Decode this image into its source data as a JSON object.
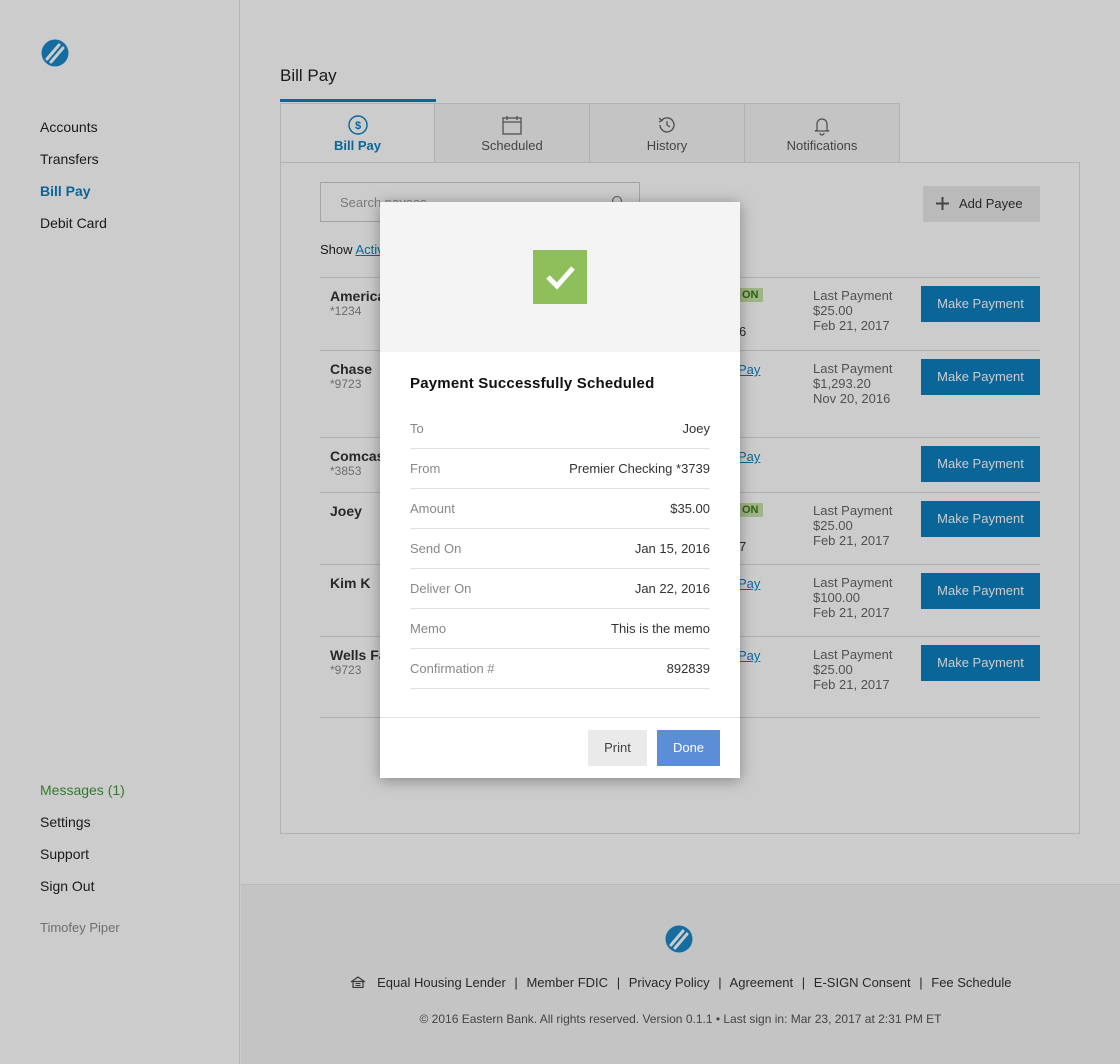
{
  "sidebar": {
    "nav": [
      "Accounts",
      "Transfers",
      "Bill Pay",
      "Debit Card"
    ],
    "active": "Bill Pay",
    "secondary": {
      "messages": "Messages (1)",
      "settings": "Settings",
      "support": "Support",
      "sign_out": "Sign Out"
    },
    "user_name": "Timofey Piper"
  },
  "main": {
    "title": "Bill Pay",
    "tabs": [
      {
        "label": "Bill Pay",
        "icon": "dollar-circle-icon"
      },
      {
        "label": "Scheduled",
        "icon": "calendar-icon"
      },
      {
        "label": "History",
        "icon": "history-icon"
      },
      {
        "label": "Notifications",
        "icon": "bell-icon"
      }
    ],
    "search_placeholder": "Search payees",
    "add_payee": "Add Payee",
    "show_label": "Show",
    "show_filter": "Active",
    "payees": [
      {
        "name": "America",
        "account": "*1234",
        "badge": "ON",
        "trail": "6",
        "last_label": "Last Payment",
        "last_amount": "$25.00",
        "last_date": "Feb 21, 2017",
        "button": "Make Payment"
      },
      {
        "name": "Chase",
        "account": "*9723",
        "link": "Pay",
        "last_label": "Last Payment",
        "last_amount": "$1,293.20",
        "last_date": "Nov 20, 2016",
        "button": "Make Payment"
      },
      {
        "name": "Comcas",
        "account": "*3853",
        "link": "Pay",
        "button": "Make Payment"
      },
      {
        "name": "Joey",
        "account": "",
        "badge": "ON",
        "trail": "7",
        "last_label": "Last Payment",
        "last_amount": "$25.00",
        "last_date": "Feb 21, 2017",
        "button": "Make Payment"
      },
      {
        "name": "Kim K",
        "account": "",
        "link": "Pay",
        "last_label": "Last Payment",
        "last_amount": "$100.00",
        "last_date": "Feb 21, 2017",
        "button": "Make Payment"
      },
      {
        "name": "Wells Fa",
        "account": "*9723",
        "link": "Pay",
        "last_label": "Last Payment",
        "last_amount": "$25.00",
        "last_date": "Feb 21, 2017",
        "button": "Make Payment"
      }
    ]
  },
  "modal": {
    "title": "Payment Successfully Scheduled",
    "rows": [
      {
        "label": "To",
        "value": "Joey"
      },
      {
        "label": "From",
        "value": "Premier Checking *3739"
      },
      {
        "label": "Amount",
        "value": "$35.00"
      },
      {
        "label": "Send On",
        "value": "Jan 15, 2016"
      },
      {
        "label": "Deliver On",
        "value": "Jan 22, 2016"
      },
      {
        "label": "Memo",
        "value": "This is the memo"
      },
      {
        "label": "Confirmation #",
        "value": "892839"
      }
    ],
    "print": "Print",
    "done": "Done"
  },
  "footer": {
    "links": [
      "Equal Housing Lender",
      "Member FDIC",
      "Privacy Policy",
      "Agreement",
      "E-SIGN Consent",
      "Fee Schedule"
    ],
    "copyright": "© 2016 Eastern Bank. All rights reserved. Version 0.1.1 • Last sign in: Mar 23, 2017 at 2:31 PM ET"
  },
  "colors": {
    "accent": "#0d7fc0",
    "success": "#8ebf5a",
    "done_button": "#5b8ed6",
    "messages": "#3f9a3a"
  }
}
